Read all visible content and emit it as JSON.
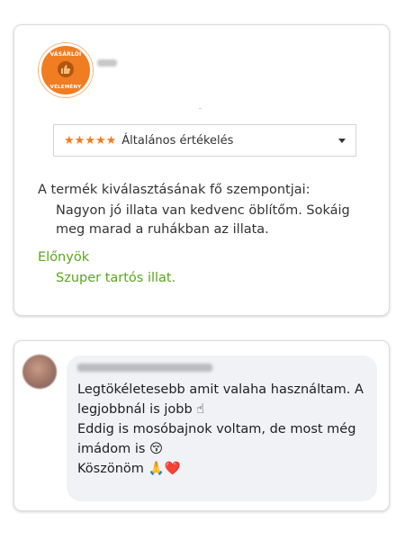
{
  "review_card": {
    "badge_text_top": "VÁSÁRLÓI",
    "badge_text_bottom": "VÉLEMÉNY",
    "rating_stars": 5,
    "rating_max": 5,
    "rating_label": "Általános értékelés",
    "criteria_title": "A termék kiválasztásának fő szempontjai:",
    "criteria_text": "Nagyon jó illata van kedvenc öblítőm. Sokáig meg marad a ruhákban az illata.",
    "pros_title": "Előnyök",
    "pros_text": "Szuper tartós illat.",
    "accent_color": "#f07d22",
    "pros_color": "#5aa61d"
  },
  "comment_card": {
    "lines": [
      "Legtökéletesebb amit valaha használtam. A",
      "legjobbnál is jobb ☝",
      "Eddig is mosóbajnok voltam, de most még",
      "imádom is 😚",
      "Köszönöm 🙏❤️"
    ],
    "bubble_color": "#f0f2f5"
  }
}
